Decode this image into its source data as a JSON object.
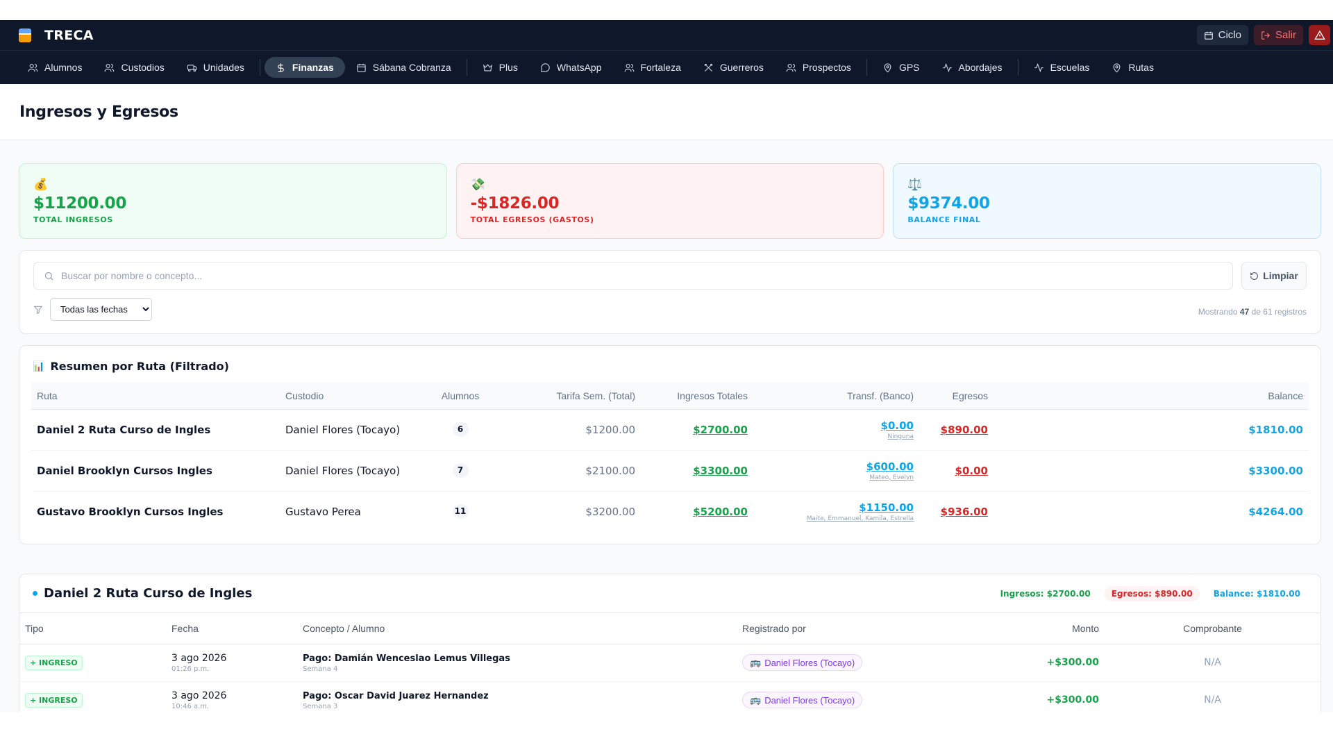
{
  "app": {
    "name": "TRECA",
    "ciclo_label": "Ciclo",
    "salir_label": "Salir"
  },
  "nav": [
    {
      "label": "Alumnos",
      "icon": "users-icon"
    },
    {
      "label": "Custodios",
      "icon": "users-icon"
    },
    {
      "label": "Unidades",
      "icon": "bus-icon"
    },
    {
      "label": "Finanzas",
      "icon": "dollar-icon",
      "active": true
    },
    {
      "label": "Sábana Cobranza",
      "icon": "calendar-icon"
    },
    {
      "label": "Plus",
      "icon": "crown-icon"
    },
    {
      "label": "WhatsApp",
      "icon": "chat-icon"
    },
    {
      "label": "Fortaleza",
      "icon": "users-icon"
    },
    {
      "label": "Guerreros",
      "icon": "swords-icon"
    },
    {
      "label": "Prospectos",
      "icon": "users-icon"
    },
    {
      "label": "GPS",
      "icon": "pin-icon"
    },
    {
      "label": "Abordajes",
      "icon": "activity-icon"
    },
    {
      "label": "Escuelas",
      "icon": "activity-icon"
    },
    {
      "label": "Rutas",
      "icon": "pin-icon"
    }
  ],
  "page": {
    "title": "Ingresos y Egresos"
  },
  "cards": {
    "ingresos": {
      "icon": "💰",
      "amount": "$11200.00",
      "label": "TOTAL INGRESOS"
    },
    "egresos": {
      "icon": "💸",
      "amount": "-$1826.00",
      "label": "TOTAL EGRESOS (GASTOS)"
    },
    "balance": {
      "icon": "⚖️",
      "amount": "$9374.00",
      "label": "BALANCE FINAL"
    }
  },
  "filters": {
    "search_placeholder": "Buscar por nombre o concepto...",
    "clear_label": "Limpiar",
    "date_selected": "Todas las fechas",
    "showing_prefix": "Mostrando",
    "showing_count": "47",
    "showing_suffix": "de 61 registros"
  },
  "summary": {
    "title": "Resumen por Ruta (Filtrado)",
    "headers": {
      "ruta": "Ruta",
      "custodio": "Custodio",
      "alumnos": "Alumnos",
      "tarifa": "Tarifa Sem. (Total)",
      "ingresos": "Ingresos Totales",
      "transf": "Transf. (Banco)",
      "egresos": "Egresos",
      "balance": "Balance"
    },
    "rows": [
      {
        "ruta": "Daniel 2 Ruta Curso de Ingles",
        "custodio": "Daniel Flores (Tocayo)",
        "alumnos": "6",
        "tarifa": "$1200.00",
        "ingresos": "$2700.00",
        "transf": "$0.00",
        "transf_who": "Ninguna",
        "egresos": "$890.00",
        "balance": "$1810.00"
      },
      {
        "ruta": "Daniel Brooklyn Cursos Ingles",
        "custodio": "Daniel Flores (Tocayo)",
        "alumnos": "7",
        "tarifa": "$2100.00",
        "ingresos": "$3300.00",
        "transf": "$600.00",
        "transf_who": "Mateo, Evelyn",
        "egresos": "$0.00",
        "balance": "$3300.00"
      },
      {
        "ruta": "Gustavo Brooklyn Cursos Ingles",
        "custodio": "Gustavo Perea",
        "alumnos": "11",
        "tarifa": "$3200.00",
        "ingresos": "$5200.00",
        "transf": "$1150.00",
        "transf_who": "Maite, Emmanuel, Kamila, Estrella",
        "egresos": "$936.00",
        "balance": "$4264.00"
      }
    ]
  },
  "detail": {
    "title": "Daniel 2 Ruta Curso de Ingles",
    "ingresos": "Ingresos: $2700.00",
    "egresos": "Egresos: $890.00",
    "balance": "Balance: $1810.00",
    "headers": {
      "tipo": "Tipo",
      "fecha": "Fecha",
      "concepto": "Concepto / Alumno",
      "registrado": "Registrado por",
      "monto": "Monto",
      "comprobante": "Comprobante"
    },
    "rows": [
      {
        "tipo": "+ INGRESO",
        "fecha": "3 ago 2026",
        "hora": "01:26 p.m.",
        "concepto": "Pago: Damián Wenceslao Lemus Villegas",
        "semana": "Semana 4",
        "registrado": "Daniel Flores (Tocayo)",
        "monto": "+$300.00",
        "comprobante": "N/A"
      },
      {
        "tipo": "+ INGRESO",
        "fecha": "3 ago 2026",
        "hora": "10:46 a.m.",
        "concepto": "Pago: Oscar David Juarez Hernandez",
        "semana": "Semana 3",
        "registrado": "Daniel Flores (Tocayo)",
        "monto": "+$300.00",
        "comprobante": "N/A"
      }
    ]
  },
  "colors": {
    "nav_bg": "#0f172a",
    "green": "#16a34a",
    "red": "#dc2626",
    "blue": "#0ea5e9",
    "purple": "#7c3aed"
  }
}
